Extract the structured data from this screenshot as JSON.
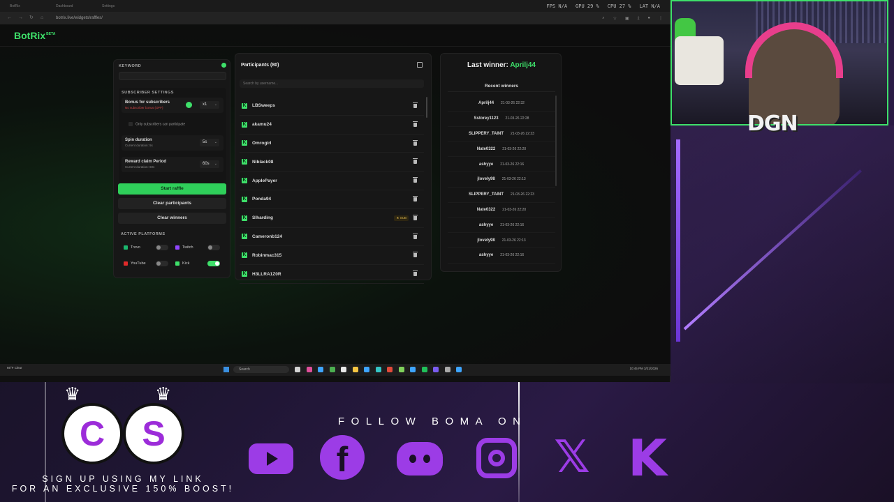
{
  "browser": {
    "tabs": [
      "BotRix",
      "Dashboard",
      "Settings"
    ],
    "perf": {
      "fps": "FPS N/A",
      "gpu": "GPU 29 %",
      "cpu": "CPU 27 %",
      "lat": "LAT N/A"
    },
    "url": "botrix.live/widgets/raffles/"
  },
  "site": {
    "logo": "BotRix",
    "logo_badge": "BETA"
  },
  "settings": {
    "keyword_label": "KEYWORD",
    "subscriber_label": "SUBSCRIBER SETTINGS",
    "bonus": {
      "title": "Bonus for subscribers",
      "sub": "No subscriber bonus (OFF)",
      "value": "x1"
    },
    "only_subs": "Only subscribers can participate",
    "spin": {
      "title": "Spin duration",
      "sub": "Current duration: 5s",
      "value": "5s"
    },
    "reward": {
      "title": "Reward claim Period",
      "sub": "Current duration: 60s",
      "value": "60s"
    },
    "start_btn": "Start raffle",
    "clear_participants_btn": "Clear participants",
    "clear_winners_btn": "Clear winners",
    "platforms_label": "ACTIVE PLATFORMS",
    "platforms": [
      {
        "name": "Trovo",
        "on": false,
        "color": "#1bb76e"
      },
      {
        "name": "Twitch",
        "on": false,
        "color": "#9146ff"
      },
      {
        "name": "YouTube",
        "on": false,
        "color": "#e02a2a"
      },
      {
        "name": "Kick",
        "on": true,
        "color": "#3ee06a"
      }
    ]
  },
  "participants": {
    "title": "Participants (80)",
    "search_placeholder": "Search by username...",
    "list": [
      {
        "name": "LBSweeps",
        "sub": false
      },
      {
        "name": "akamu24",
        "sub": false
      },
      {
        "name": "Omrogirl",
        "sub": false
      },
      {
        "name": "Niblack08",
        "sub": false
      },
      {
        "name": "ApplePayer",
        "sub": false
      },
      {
        "name": "Ponda94",
        "sub": false
      },
      {
        "name": "Slharding",
        "sub": true
      },
      {
        "name": "Cameronb124",
        "sub": false
      },
      {
        "name": "Robinmac315",
        "sub": false
      },
      {
        "name": "H3LLRA1Z0R",
        "sub": false
      }
    ],
    "sub_badge": "★ SUB"
  },
  "winners": {
    "last_label": "Last winner:",
    "last_name": "Aprilj44",
    "recent_title": "Recent winners",
    "list": [
      {
        "name": "Aprilj44",
        "date": "21-03-26 22:32"
      },
      {
        "name": "Sstorey1123",
        "date": "21-03-26 22:28"
      },
      {
        "name": "SLIPPERY_TAINT",
        "date": "21-03-26 22:23"
      },
      {
        "name": "Nate0322",
        "date": "21-03-26 22:20"
      },
      {
        "name": "ashyye",
        "date": "21-03-26 22:16"
      },
      {
        "name": "jlovely98",
        "date": "21-03-26 22:13"
      },
      {
        "name": "SLIPPERY_TAINT",
        "date": "21-03-26 22:23"
      },
      {
        "name": "Nate0322",
        "date": "21-03-26 22:20"
      },
      {
        "name": "ashyye",
        "date": "21-03-26 22:16"
      },
      {
        "name": "jlovely98",
        "date": "21-03-26 22:13"
      },
      {
        "name": "ashyye",
        "date": "21-03-26 22:16"
      }
    ]
  },
  "taskbar": {
    "weather": "66°F Clear",
    "search": "Search",
    "tray_time": "10:45 PM",
    "tray_date": "3/21/2026",
    "app_colors": [
      "#d3d3d3",
      "#e04f9a",
      "#3ea5ff",
      "#4caf50",
      "#e8e8e8",
      "#f4c542",
      "#3ea5ff",
      "#34c6c6",
      "#e24a3a",
      "#7fd15b",
      "#3ea5ff",
      "#20c05a",
      "#7a5cf0",
      "#aaaaaa",
      "#3ea5ff"
    ]
  },
  "overlay": {
    "webcam_tag": "DGN",
    "cs_left": "C",
    "cs_right": "S",
    "signup_line1": "SIGN UP USING MY LINK",
    "signup_line2": "FOR AN EXCLUSIVE 150% BOOST!",
    "follow": "FOLLOW BOMA ON",
    "socials": [
      "youtube-icon",
      "facebook-icon",
      "discord-icon",
      "instagram-icon",
      "x-icon",
      "kick-icon"
    ],
    "accent": "#9c3ce6"
  }
}
